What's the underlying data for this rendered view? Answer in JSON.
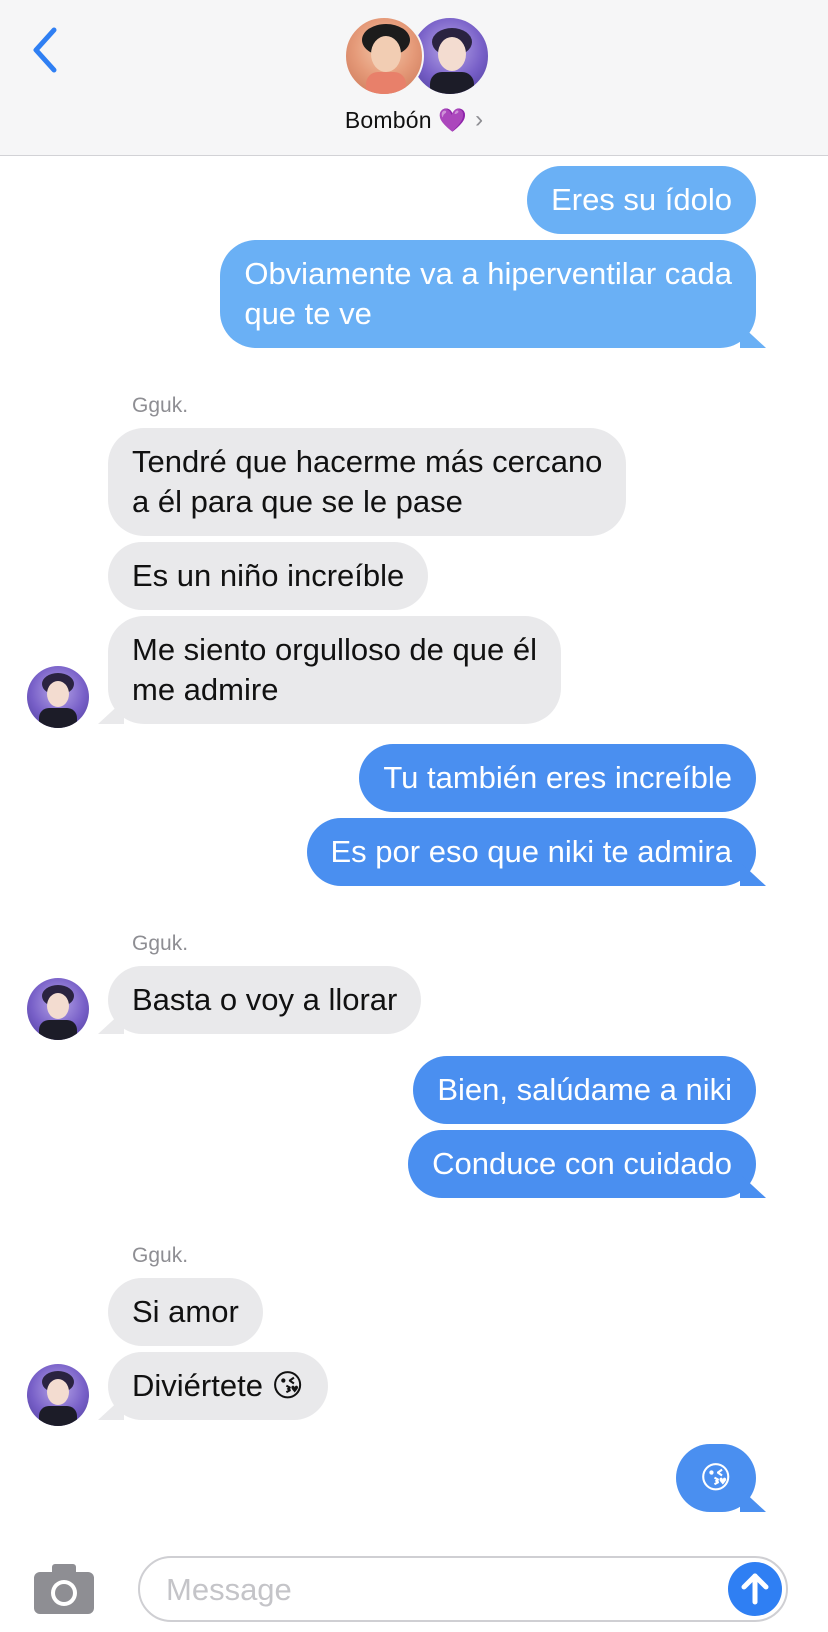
{
  "header": {
    "contact_name": "Bombón 💜",
    "chevron": "›",
    "back_icon": "chevron-left-icon"
  },
  "colors": {
    "accent": "#2f7ff3",
    "bubble_out_light": "#6ab0f5",
    "bubble_out_dark": "#4a8ff0",
    "bubble_in": "#e9e9eb"
  },
  "messages": [
    {
      "dir": "out",
      "text": "Eres su ídolo"
    },
    {
      "dir": "out",
      "text_lines": [
        "Obviamente va a hiperventilar cada",
        "que te ve"
      ]
    },
    {
      "sender": "Gguk."
    },
    {
      "dir": "in",
      "text_lines": [
        "Tendré que hacerme más cercano",
        "a él para que se le pase"
      ]
    },
    {
      "dir": "in",
      "text": "Es un niño increíble"
    },
    {
      "dir": "in",
      "text_lines": [
        "Me siento orgulloso de que él",
        "me admire"
      ]
    },
    {
      "dir": "out",
      "text": "Tu también eres increíble"
    },
    {
      "dir": "out",
      "text": "Es por eso que niki te admira"
    },
    {
      "sender": "Gguk."
    },
    {
      "dir": "in",
      "text": "Basta o voy a llorar"
    },
    {
      "dir": "out",
      "text": "Bien, salúdame a niki"
    },
    {
      "dir": "out",
      "text": "Conduce con cuidado"
    },
    {
      "sender": "Gguk."
    },
    {
      "dir": "in",
      "text": "Si amor"
    },
    {
      "dir": "in",
      "text": "Diviértete 😘"
    },
    {
      "dir": "out",
      "text": "😘"
    }
  ],
  "input": {
    "placeholder": "Message",
    "camera_icon": "camera-icon",
    "send_icon": "arrow-up-icon"
  }
}
